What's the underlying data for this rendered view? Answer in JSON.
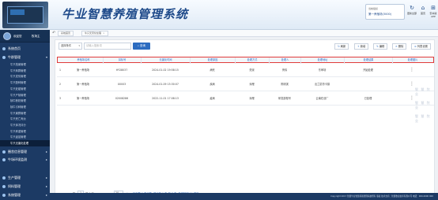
{
  "app_title": "牛业智慧养殖管理系统",
  "header": {
    "env_label": "当前组织",
    "env_value": "第一养殖场(3000)",
    "icons": [
      {
        "name": "refresh-icon",
        "glyph": "↻",
        "label": "更新全部"
      },
      {
        "name": "home-icon",
        "glyph": "⌂",
        "label": "首页"
      },
      {
        "name": "app-icon",
        "glyph": "⊞",
        "label": "安卓版APP"
      }
    ]
  },
  "sidebar": {
    "user_name": "欢迎您",
    "role": "牧场主",
    "sections": [
      {
        "label": "系统首页"
      },
      {
        "label": "牛群管理"
      }
    ],
    "subitems": [
      "牛只档案管理",
      "牛只转群管理",
      "牛只发情管理",
      "牛只配种管理",
      "牛只妊娠管理",
      "牛只产犊管理",
      "犊牛断奶管理",
      "犊牛引种管理",
      "牛只离群管理",
      "牛只死亡淘汰",
      "牛只体况评分",
      "牛只称重管理",
      "牛只疫苗管理"
    ],
    "active_sub": "牛只无害化处理",
    "more_sections": [
      {
        "label": "圈舍信息管理"
      },
      {
        "label": "牛场环境监测"
      }
    ],
    "bottom_sections": [
      {
        "label": "生产管理"
      },
      {
        "label": "饲料管理"
      },
      {
        "label": "系统管理"
      }
    ]
  },
  "tabs": {
    "items": [
      {
        "label": "系统首页"
      },
      {
        "label": "牛只无害化处理"
      }
    ]
  },
  "search": {
    "select_value": "选择条件",
    "placeholder": "请输入搜索词",
    "button_label": "查询"
  },
  "toolbar": {
    "refresh": "刷新",
    "add": "新增",
    "edit": "编辑",
    "delete": "删除",
    "column_settings": "列表设置"
  },
  "table": {
    "columns": [
      "养殖场名称",
      "耳标号",
      "无害化时间",
      "处理原因",
      "处理方式",
      "处理人",
      "处理地址",
      "处理结果",
      "处理图片"
    ],
    "rows": [
      {
        "idx": "1",
        "farm": "第一养殖场",
        "ear": "HY28037",
        "time": "2024-01-02 19:58:15",
        "reason": "病死",
        "method": "焚烧",
        "person": "黄伟",
        "address": "东审场",
        "result": "开始处理"
      },
      {
        "idx": "2",
        "farm": "第一养殖场",
        "ear": "X0003",
        "time": "2024-01-09 15:30:07",
        "reason": "疾病",
        "method": "深埋",
        "person": "陈明滨",
        "address": "出兰蒙昂卡镇",
        "result": ""
      },
      {
        "idx": "3",
        "farm": "第一养殖场",
        "ear": "02008286",
        "time": "2022-11-01 17:08:13",
        "reason": "疫病",
        "method": "深埋",
        "person": "研发部账号",
        "address": "云南在创厂",
        "result": "已处理"
      }
    ]
  },
  "watermark": "智 慧 牧 业",
  "pager": {
    "page": "1",
    "of_label": "共 1 页",
    "page_size": "20",
    "summary": "每页数 1 条记录, 显示第 1 条-第 3 条, 耗时耗时 11 毫秒"
  },
  "footer": "Copyright 2017 智慧牛业智慧养殖管理系统所有 版权 技术支持：智慧牧业技术有限公司 电话：000-0000 000"
}
